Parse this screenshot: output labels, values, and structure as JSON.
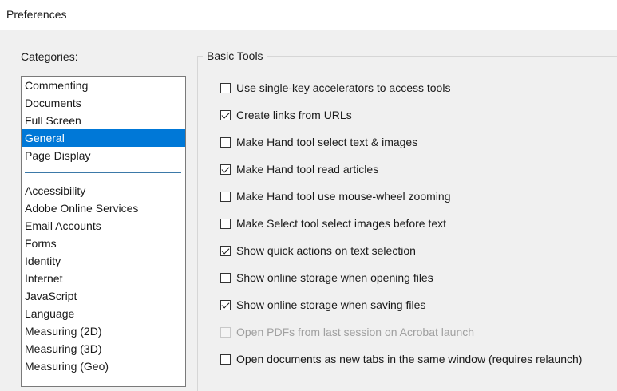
{
  "window": {
    "title": "Preferences"
  },
  "categories": {
    "label": "Categories:",
    "top_items": [
      "Commenting",
      "Documents",
      "Full Screen",
      "General",
      "Page Display"
    ],
    "selected": "General",
    "other_items": [
      "Accessibility",
      "Adobe Online Services",
      "Email Accounts",
      "Forms",
      "Identity",
      "Internet",
      "JavaScript",
      "Language",
      "Measuring (2D)",
      "Measuring (3D)",
      "Measuring (Geo)"
    ]
  },
  "basic_tools": {
    "title": "Basic Tools",
    "options": [
      {
        "label": "Use single-key accelerators to access tools",
        "checked": false,
        "disabled": false
      },
      {
        "label": "Create links from URLs",
        "checked": true,
        "disabled": false
      },
      {
        "label": "Make Hand tool select text & images",
        "checked": false,
        "disabled": false
      },
      {
        "label": "Make Hand tool read articles",
        "checked": true,
        "disabled": false
      },
      {
        "label": "Make Hand tool use mouse-wheel zooming",
        "checked": false,
        "disabled": false
      },
      {
        "label": "Make Select tool select images before text",
        "checked": false,
        "disabled": false
      },
      {
        "label": "Show quick actions on text selection",
        "checked": true,
        "disabled": false
      },
      {
        "label": "Show online storage when opening files",
        "checked": false,
        "disabled": false
      },
      {
        "label": "Show online storage when saving files",
        "checked": true,
        "disabled": false
      },
      {
        "label": "Open PDFs from last session on Acrobat launch",
        "checked": false,
        "disabled": true
      },
      {
        "label": "Open documents as new tabs in the same window (requires relaunch)",
        "checked": false,
        "disabled": false
      }
    ]
  },
  "colors": {
    "selection": "#0078d7",
    "separator": "#3b79a8"
  }
}
